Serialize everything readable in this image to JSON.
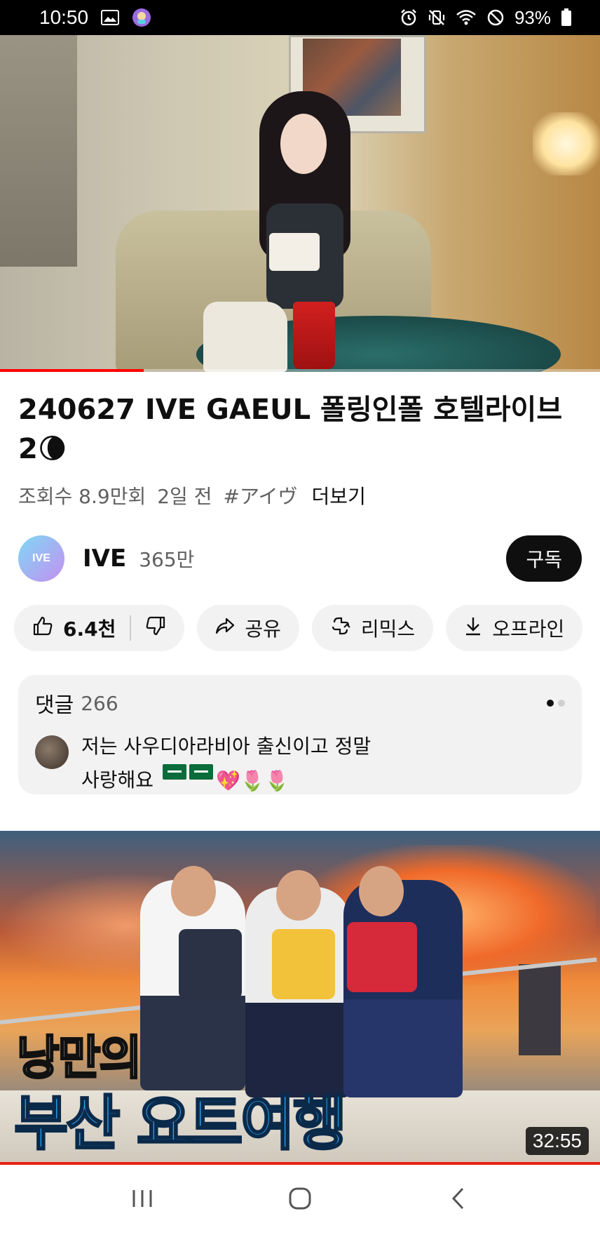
{
  "status_bar": {
    "time": "10:50",
    "battery": "93%",
    "icons": [
      "image-icon",
      "app-notification-icon",
      "alarm-icon",
      "vibrate-mute-icon",
      "wifi-icon",
      "do-not-disturb-icon",
      "battery-icon"
    ]
  },
  "player": {
    "progress_fraction": 0.24
  },
  "video": {
    "title": "240627 IVE GAEUL 폴링인폴 호텔라이브2🌘",
    "views": "조회수 8.9만회",
    "age": "2일 전",
    "hashtag": "#アイヴ",
    "more": "더보기"
  },
  "channel": {
    "avatar_text": "IVE",
    "name": "IVE",
    "subscribers": "365만",
    "subscribe_label": "구독"
  },
  "actions": {
    "like_count": "6.4천",
    "share_label": "공유",
    "remix_label": "리믹스",
    "download_label": "오프라인"
  },
  "comments": {
    "header": "댓글",
    "count": "266",
    "top_comment_line1": "저는 사우디아라비아 출신이고 정말",
    "top_comment_line2": "사랑해요",
    "top_comment_emoji": "💖🌷🌷"
  },
  "next_video": {
    "thumbnail_line1": "낭만의",
    "thumbnail_line2": "부산 요트여행",
    "duration": "32:55"
  },
  "colors": {
    "accent_red": "#ff0000",
    "chip_bg": "#f2f2f2",
    "subscribe_bg": "#0f0f0f",
    "thumbnail_title_blue": "#2aa6f5"
  }
}
